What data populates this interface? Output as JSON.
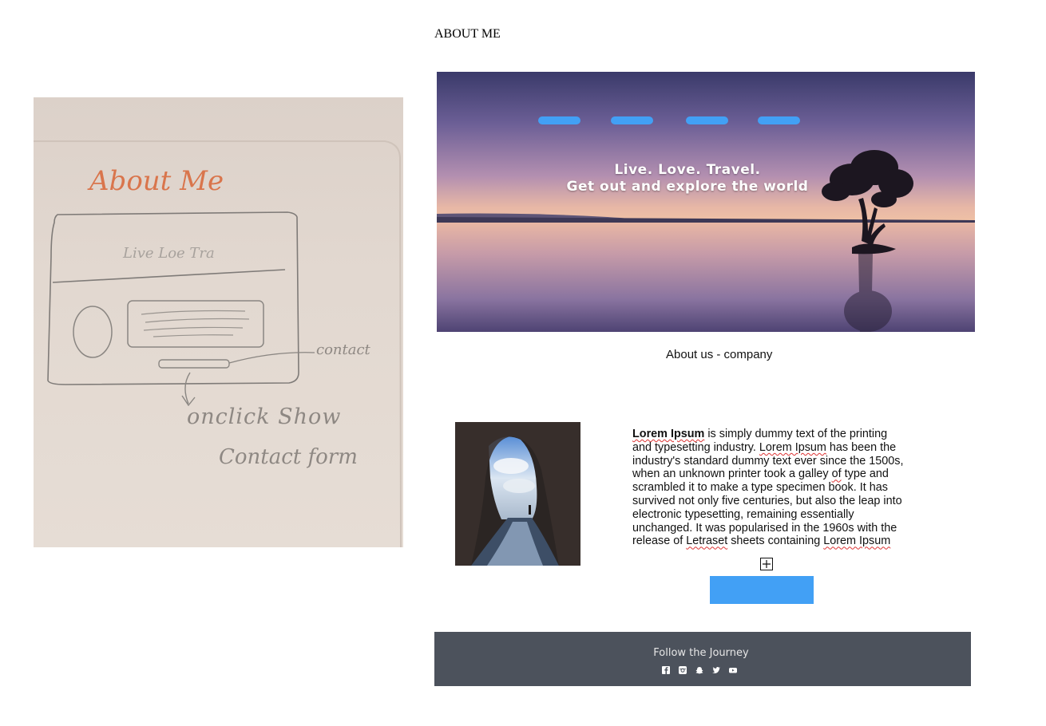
{
  "page": {
    "title": "ABOUT ME"
  },
  "sketch": {
    "heading": "About Me",
    "banner_text": "Live Loe Tra",
    "contact_note": "contact",
    "onclick_note_1": "onclick Show",
    "onclick_note_2": "Contact form"
  },
  "hero": {
    "tagline_1": "Live. Love. Travel.",
    "tagline_2": "Get out and explore the world",
    "nav_items": 4,
    "accent_color": "#42a0f5"
  },
  "about": {
    "subtitle": "About us - company",
    "body_bold": "Lorem Ipsum",
    "body_1": " is simply dummy text of the printing and typesetting industry. ",
    "body_sq_1": "Lorem Ipsum",
    "body_2": " has been the industry's standard dummy text ever since the 1500s, when an unknown printer took a galley ",
    "body_sq_2": "of",
    "body_3": " type and scrambled it to make a type specimen book. It has survived not only five centuries, but also the leap into electronic typesetting, remaining essentially unchanged. It was popularised in the 1960s with the release of ",
    "body_sq_3": "Letraset",
    "body_4": " sheets containing ",
    "body_sq_4": "Lorem Ipsum",
    "button_label": ""
  },
  "footer": {
    "title": "Follow the Journey",
    "icons": [
      "facebook-icon",
      "instagram-icon",
      "snapchat-icon",
      "twitter-icon",
      "youtube-icon"
    ],
    "bg_color": "#4c525c"
  }
}
